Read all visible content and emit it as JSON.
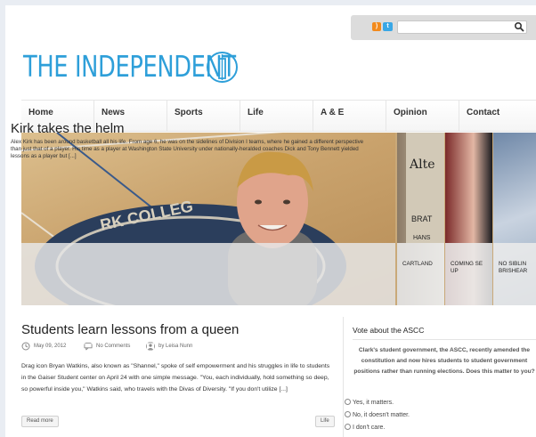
{
  "header": {
    "logo_text": "THE INDEPENDENT",
    "search_placeholder": ""
  },
  "nav": {
    "items": [
      "Home",
      "News",
      "Sports",
      "Life",
      "A & E",
      "Opinion",
      "Contact"
    ]
  },
  "slider": {
    "title": "Kirk takes the helm",
    "text": "Alex Kirk has been around basketball all his life. From age 6, he was on the sidelines of Division I teams, where he gained a different perspective than just that of a player. His time as a player at Washington State University under nationally-heralded coaches Dick and Tony Bennett yielded lessons as a player but [...]",
    "side_captions": [
      "CARTLAND",
      "COMING SE UP",
      "NO SIBLIN BRISHEAR"
    ]
  },
  "article": {
    "title": "Students learn lessons from a queen",
    "date": "May 09, 2012",
    "comments": "No Comments",
    "author": "by Leisa Nunn",
    "text": "Drag icon Bryan Watkins, also known as \"Shannel,\" spoke of self empowerment and his struggles in life to students in the Gaiser Student center on April 24 with one simple message. \"You, each individually, hold something so deep, so powerful inside you,\" Watkins said, who travels with the Divas of Diversity. \"If you don't utilize [...]",
    "read_more": "Read more",
    "category": "Life"
  },
  "poll": {
    "heading": "Vote about the ASCC",
    "question": "Clark's student government, the ASCC, recently amended the constitution and now hires students to student government positions rather than running elections. Does this matter to you?",
    "options": [
      "Yes, it matters.",
      "No, it doesn't matter.",
      "I don't care."
    ]
  },
  "colors": {
    "brand": "#2e9fd9",
    "rss": "#f28a1d",
    "twitter": "#39a7e6"
  }
}
